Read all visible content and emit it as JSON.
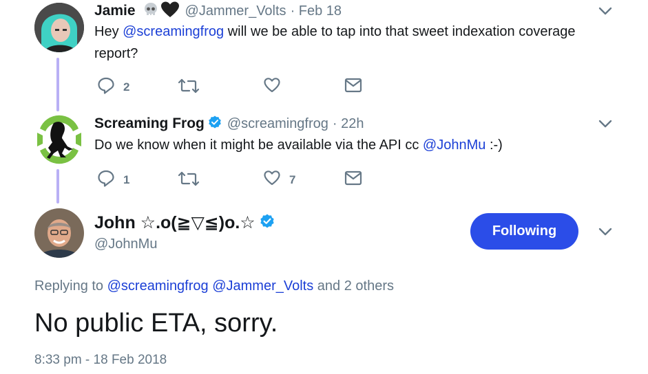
{
  "tweet1": {
    "name": "Jamie",
    "handle": "@Jammer_Volts",
    "time": "· Feb 18",
    "text_prefix": "Hey ",
    "mention": "@screamingfrog",
    "text_rest": " will we be able to tap into that sweet indexation coverage report?",
    "reply_count": "2",
    "retweet_count": "",
    "like_count": ""
  },
  "tweet2": {
    "name": "Screaming Frog",
    "handle": "@screamingfrog",
    "time": "· 22h",
    "text_prefix": "Do we know when it might be available via the API cc ",
    "mention": "@JohnMu",
    "text_rest": " :-)",
    "reply_count": "1",
    "retweet_count": "",
    "like_count": "7"
  },
  "main_tweet": {
    "name": "John ☆.o(≧▽≦)o.☆",
    "handle": "@JohnMu",
    "follow_label": "Following",
    "replying_prefix": "Replying to ",
    "replying_mention1": "@screamingfrog",
    "replying_mention2": "@Jammer_Volts",
    "replying_suffix": "and 2 others",
    "text": "No public ETA, sorry.",
    "timestamp": "8:33 pm - 18 Feb 2018"
  },
  "colors": {
    "accent": "#2b4de8",
    "thread_line": "#b9b0f5",
    "verified": "#1da1f2",
    "muted": "#657786"
  }
}
